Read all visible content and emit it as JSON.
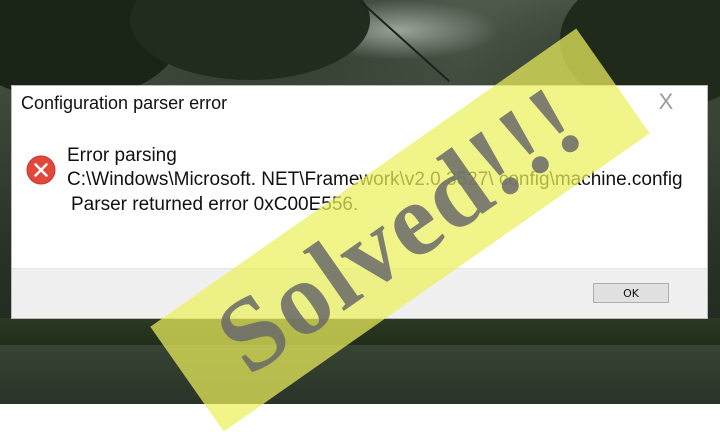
{
  "dialog": {
    "title": "Configuration parser error",
    "close_glyph": "X",
    "icon": "error-icon",
    "message_line1": "Error parsing",
    "message_line2": "C:\\Windows\\Microsoft. NET\\Framework\\v2.0.3527\\ config\\machine.config",
    "message_line3": "Parser returned error 0xC00E556.",
    "ok_label": "OK"
  },
  "overlay": {
    "text": "Solved!!!"
  },
  "colors": {
    "error_red": "#e2473a",
    "overlay_yellow": "#ecf05c",
    "overlay_text": "#696969"
  }
}
